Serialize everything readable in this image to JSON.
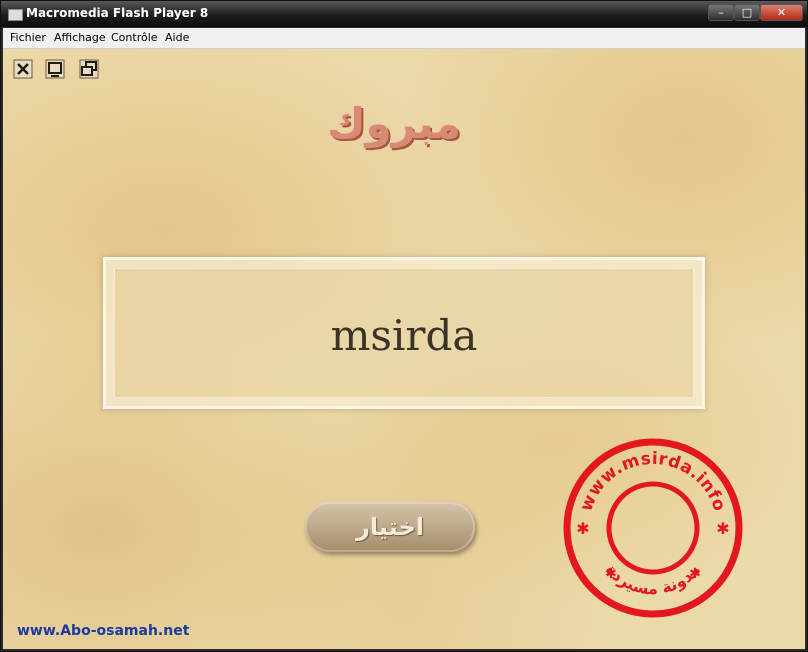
{
  "window": {
    "title": "Macromedia Flash Player 8",
    "minimize": "–",
    "maximize": "□",
    "close": "✕"
  },
  "menu": [
    {
      "label": "Fichier"
    },
    {
      "label": "Affichage"
    },
    {
      "label": "Contrôle"
    },
    {
      "label": "Aide"
    }
  ],
  "toolbar": {
    "icons": [
      "close-icon",
      "window-icon",
      "restore-icon"
    ]
  },
  "content": {
    "heading": "مبروك",
    "name": "msirda",
    "button_label": "اختيار",
    "stamp_top": "www.msirda.info",
    "stamp_bottom": "مدونة مسيردة",
    "website": "www.Abo-osamah.net"
  },
  "colors": {
    "stamp": "#e4161e",
    "link": "#1a3a9c",
    "heading": "#d98a74"
  }
}
